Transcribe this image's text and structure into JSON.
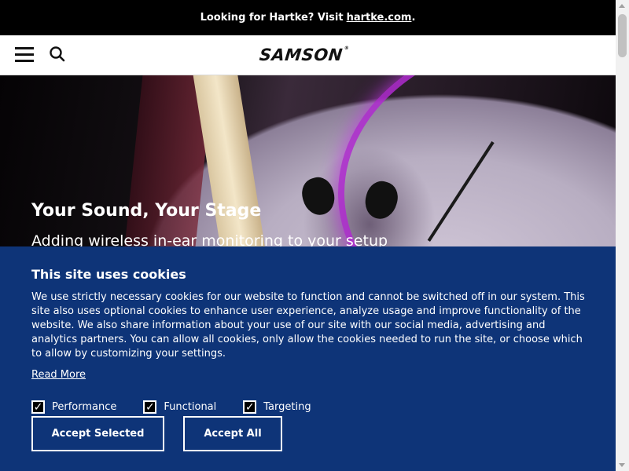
{
  "topbar": {
    "prefix": "Looking for Hartke? Visit",
    "link": "hartke.com",
    "suffix": "."
  },
  "header": {
    "logo": "SAMSON",
    "logo_mark": "®"
  },
  "hero": {
    "title": "Your Sound, Your Stage",
    "subtitle": "Adding wireless in-ear monitoring to your setup"
  },
  "cookie": {
    "title": "This site uses cookies",
    "body": "We use strictly necessary cookies for our website to function and cannot be switched off in our system. This site also uses optional cookies to enhance user experience, analyze usage and improve functionality of the website. We also share information about your use of our site with our social media, advertising and analytics partners. You can allow all cookies, only allow the cookies needed to run the site, or choose which to allow by customizing your settings.",
    "read_more": "Read More",
    "options": [
      {
        "label": "Performance",
        "checked": true
      },
      {
        "label": "Functional",
        "checked": true
      },
      {
        "label": "Targeting",
        "checked": true
      }
    ],
    "accept_selected": "Accept Selected",
    "accept_all": "Accept All"
  },
  "icons": {
    "menu": "hamburger-menu-icon",
    "search": "search-icon",
    "check": "checkmark-icon"
  },
  "colors": {
    "cookie_bg": "#0e3478",
    "topbar_bg": "#000000",
    "rim": "#b02bd0"
  }
}
